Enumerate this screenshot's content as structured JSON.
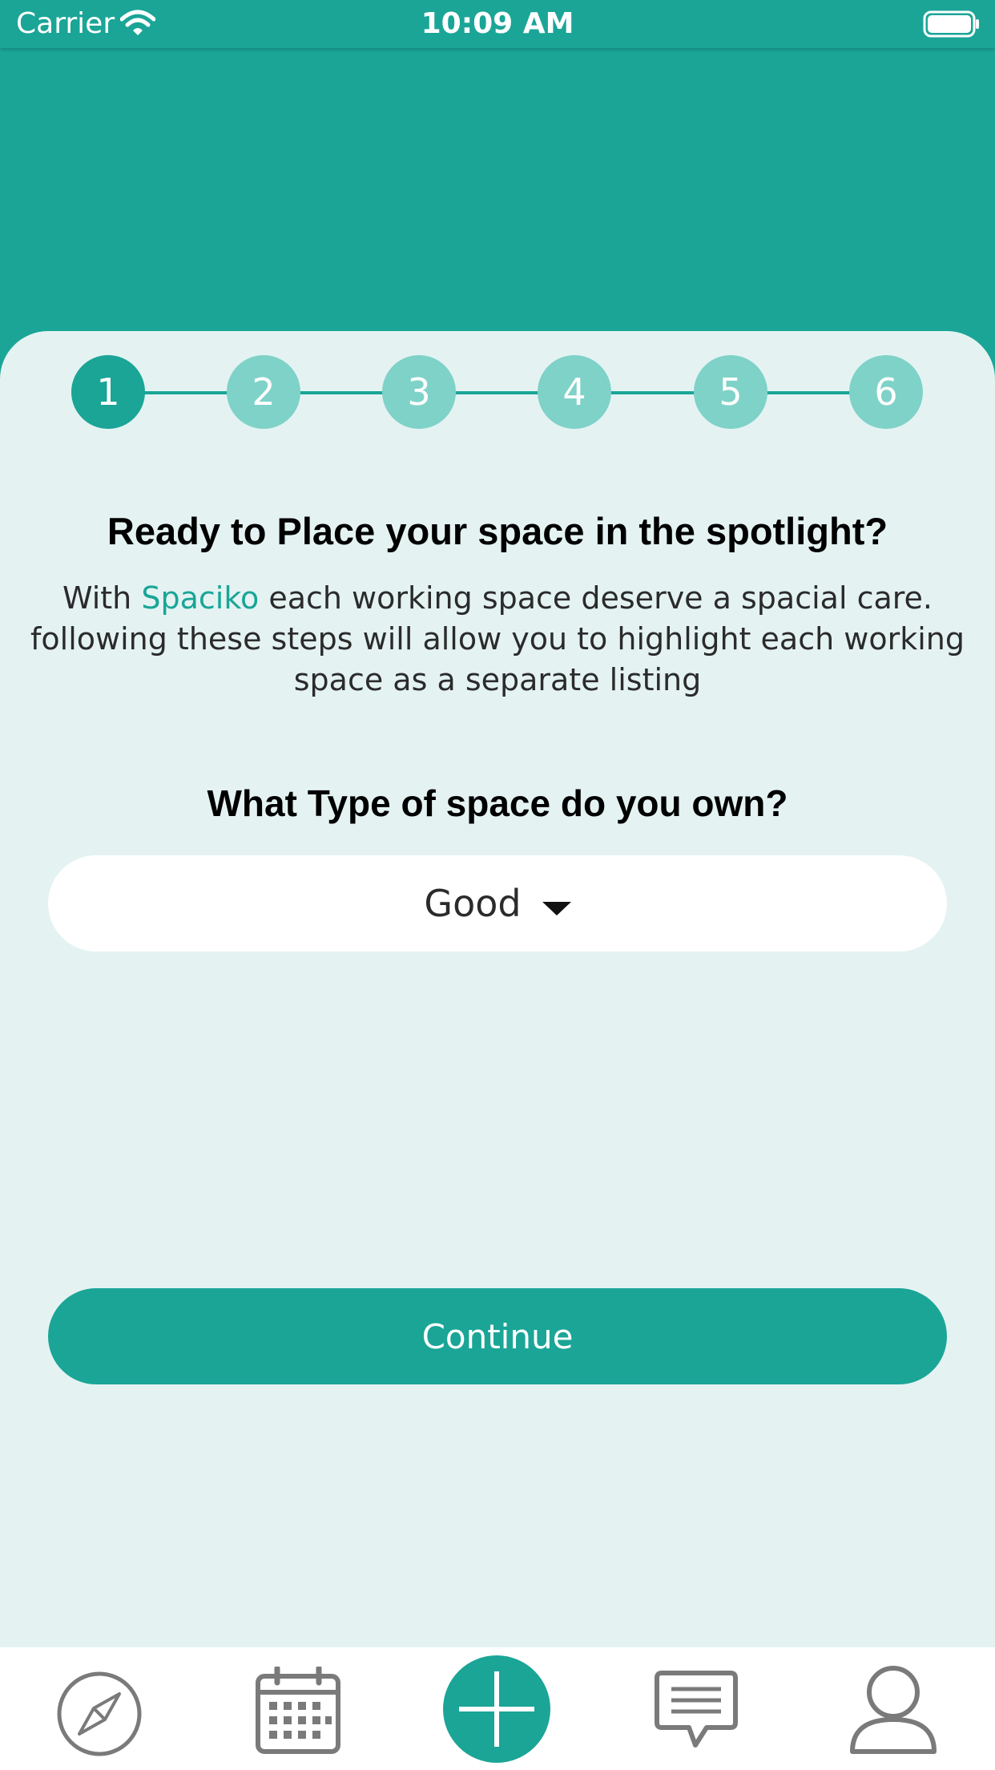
{
  "status_bar": {
    "carrier": "Carrier",
    "time": "10:09 AM"
  },
  "stepper": {
    "steps": [
      "1",
      "2",
      "3",
      "4",
      "5",
      "6"
    ],
    "active_step": 1
  },
  "heading": "Ready to Place your space in the spotlight?",
  "intro": {
    "prefix": "With ",
    "brand": "Spaciko",
    "suffix": " each working space deserve a spacial care. following these steps will allow you to highlight each working space as a separate listing"
  },
  "question": "What Type of space do you own?",
  "space_type_select": {
    "value": "Good"
  },
  "continue_label": "Continue",
  "tab_bar": {
    "items": [
      "compass-icon",
      "calendar-icon",
      "add-icon",
      "chat-icon",
      "profile-icon"
    ]
  },
  "colors": {
    "primary": "#1aa597",
    "step_inactive": "#7fd2c8",
    "card_bg": "#e4f3f2"
  }
}
